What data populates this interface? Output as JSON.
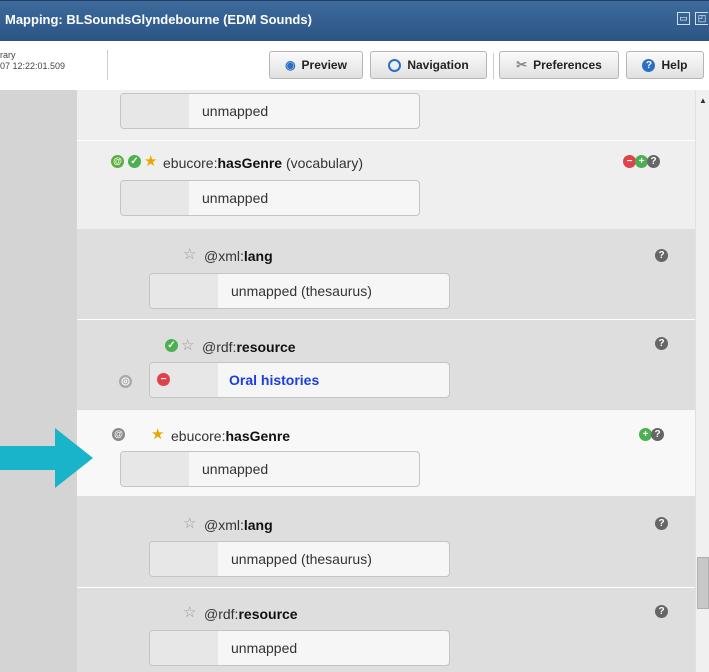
{
  "window": {
    "title": "Mapping: BLSoundsGlyndebourne (EDM Sounds)"
  },
  "status": {
    "line1": "rary",
    "line2": "07 12:22:01.509"
  },
  "toolbar": {
    "preview": "Preview",
    "navigation": "Navigation",
    "preferences": "Preferences",
    "help": "Help"
  },
  "mappings": [
    {
      "value": "unmapped"
    },
    {
      "label_prefix": "ebucore:",
      "label_name": "hasGenre",
      "label_suffix": " (vocabulary)",
      "value": "unmapped"
    },
    {
      "label_prefix": "@xml:",
      "label_name": "lang",
      "value": "unmapped (thesaurus)"
    },
    {
      "label_prefix": "@rdf:",
      "label_name": "resource",
      "value": "Oral histories"
    },
    {
      "label_prefix": "ebucore:",
      "label_name": "hasGenre",
      "value": "unmapped"
    },
    {
      "label_prefix": "@xml:",
      "label_name": "lang",
      "value": "unmapped (thesaurus)"
    },
    {
      "label_prefix": "@rdf:",
      "label_name": "resource",
      "value": "unmapped"
    }
  ],
  "colors": {
    "titlebar": "#2f5b8d",
    "arrow": "#19b4c9",
    "link": "#1a3ee0"
  },
  "icons": {
    "help": "help-icon",
    "remove": "remove-icon",
    "add": "add-icon",
    "star": "star-icon",
    "check": "check-icon",
    "attribute": "attribute-icon"
  }
}
